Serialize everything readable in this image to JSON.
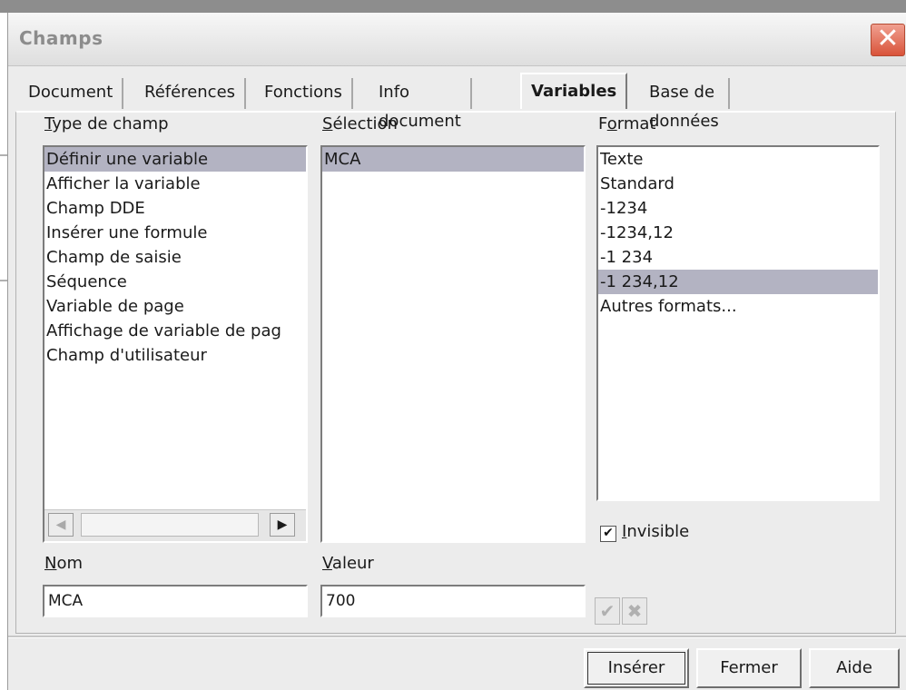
{
  "window": {
    "title": "Champs",
    "close_glyph": "✕"
  },
  "tabs": [
    {
      "label": "Document"
    },
    {
      "label": "Références"
    },
    {
      "label": "Fonctions"
    },
    {
      "label": "Info document"
    },
    {
      "label": "Variables",
      "active": true
    },
    {
      "label": "Base de données"
    }
  ],
  "type_de_champ": {
    "label_first": "T",
    "label_rest": "ype de champ",
    "items": [
      "Définir une variable",
      "Afficher la variable",
      "Champ DDE",
      "Insérer une formule",
      "Champ de saisie",
      "Séquence",
      "Variable de page",
      "Affichage de variable de pag",
      "Champ d'utilisateur"
    ],
    "selected_index": 0,
    "scroll_left_glyph": "◀",
    "scroll_right_glyph": "▶"
  },
  "selection": {
    "label_first": "S",
    "label_rest": "élection",
    "items": [
      "MCA"
    ],
    "selected_index": 0
  },
  "format": {
    "label_first": "F",
    "label_u": "o",
    "label_rest": "rmat",
    "items": [
      "Texte",
      "Standard",
      "-1234",
      "-1234,12",
      "-1 234",
      "-1 234,12",
      "Autres formats..."
    ],
    "selected_index": 5
  },
  "invisible": {
    "label_first": "I",
    "label_rest": "nvisible",
    "checked": true,
    "check_glyph": "✔"
  },
  "nom": {
    "label_first": "N",
    "label_rest": "om",
    "value": "MCA"
  },
  "valeur": {
    "label_first": "V",
    "label_rest": "aleur",
    "value": "700"
  },
  "icons": {
    "apply_glyph": "✔",
    "delete_glyph": "✖"
  },
  "buttons": {
    "insert": "Insérer",
    "close": "Fermer",
    "help": "Aide"
  },
  "colors": {
    "selection": "#b3b3c2",
    "close_button": "#d9533a"
  }
}
